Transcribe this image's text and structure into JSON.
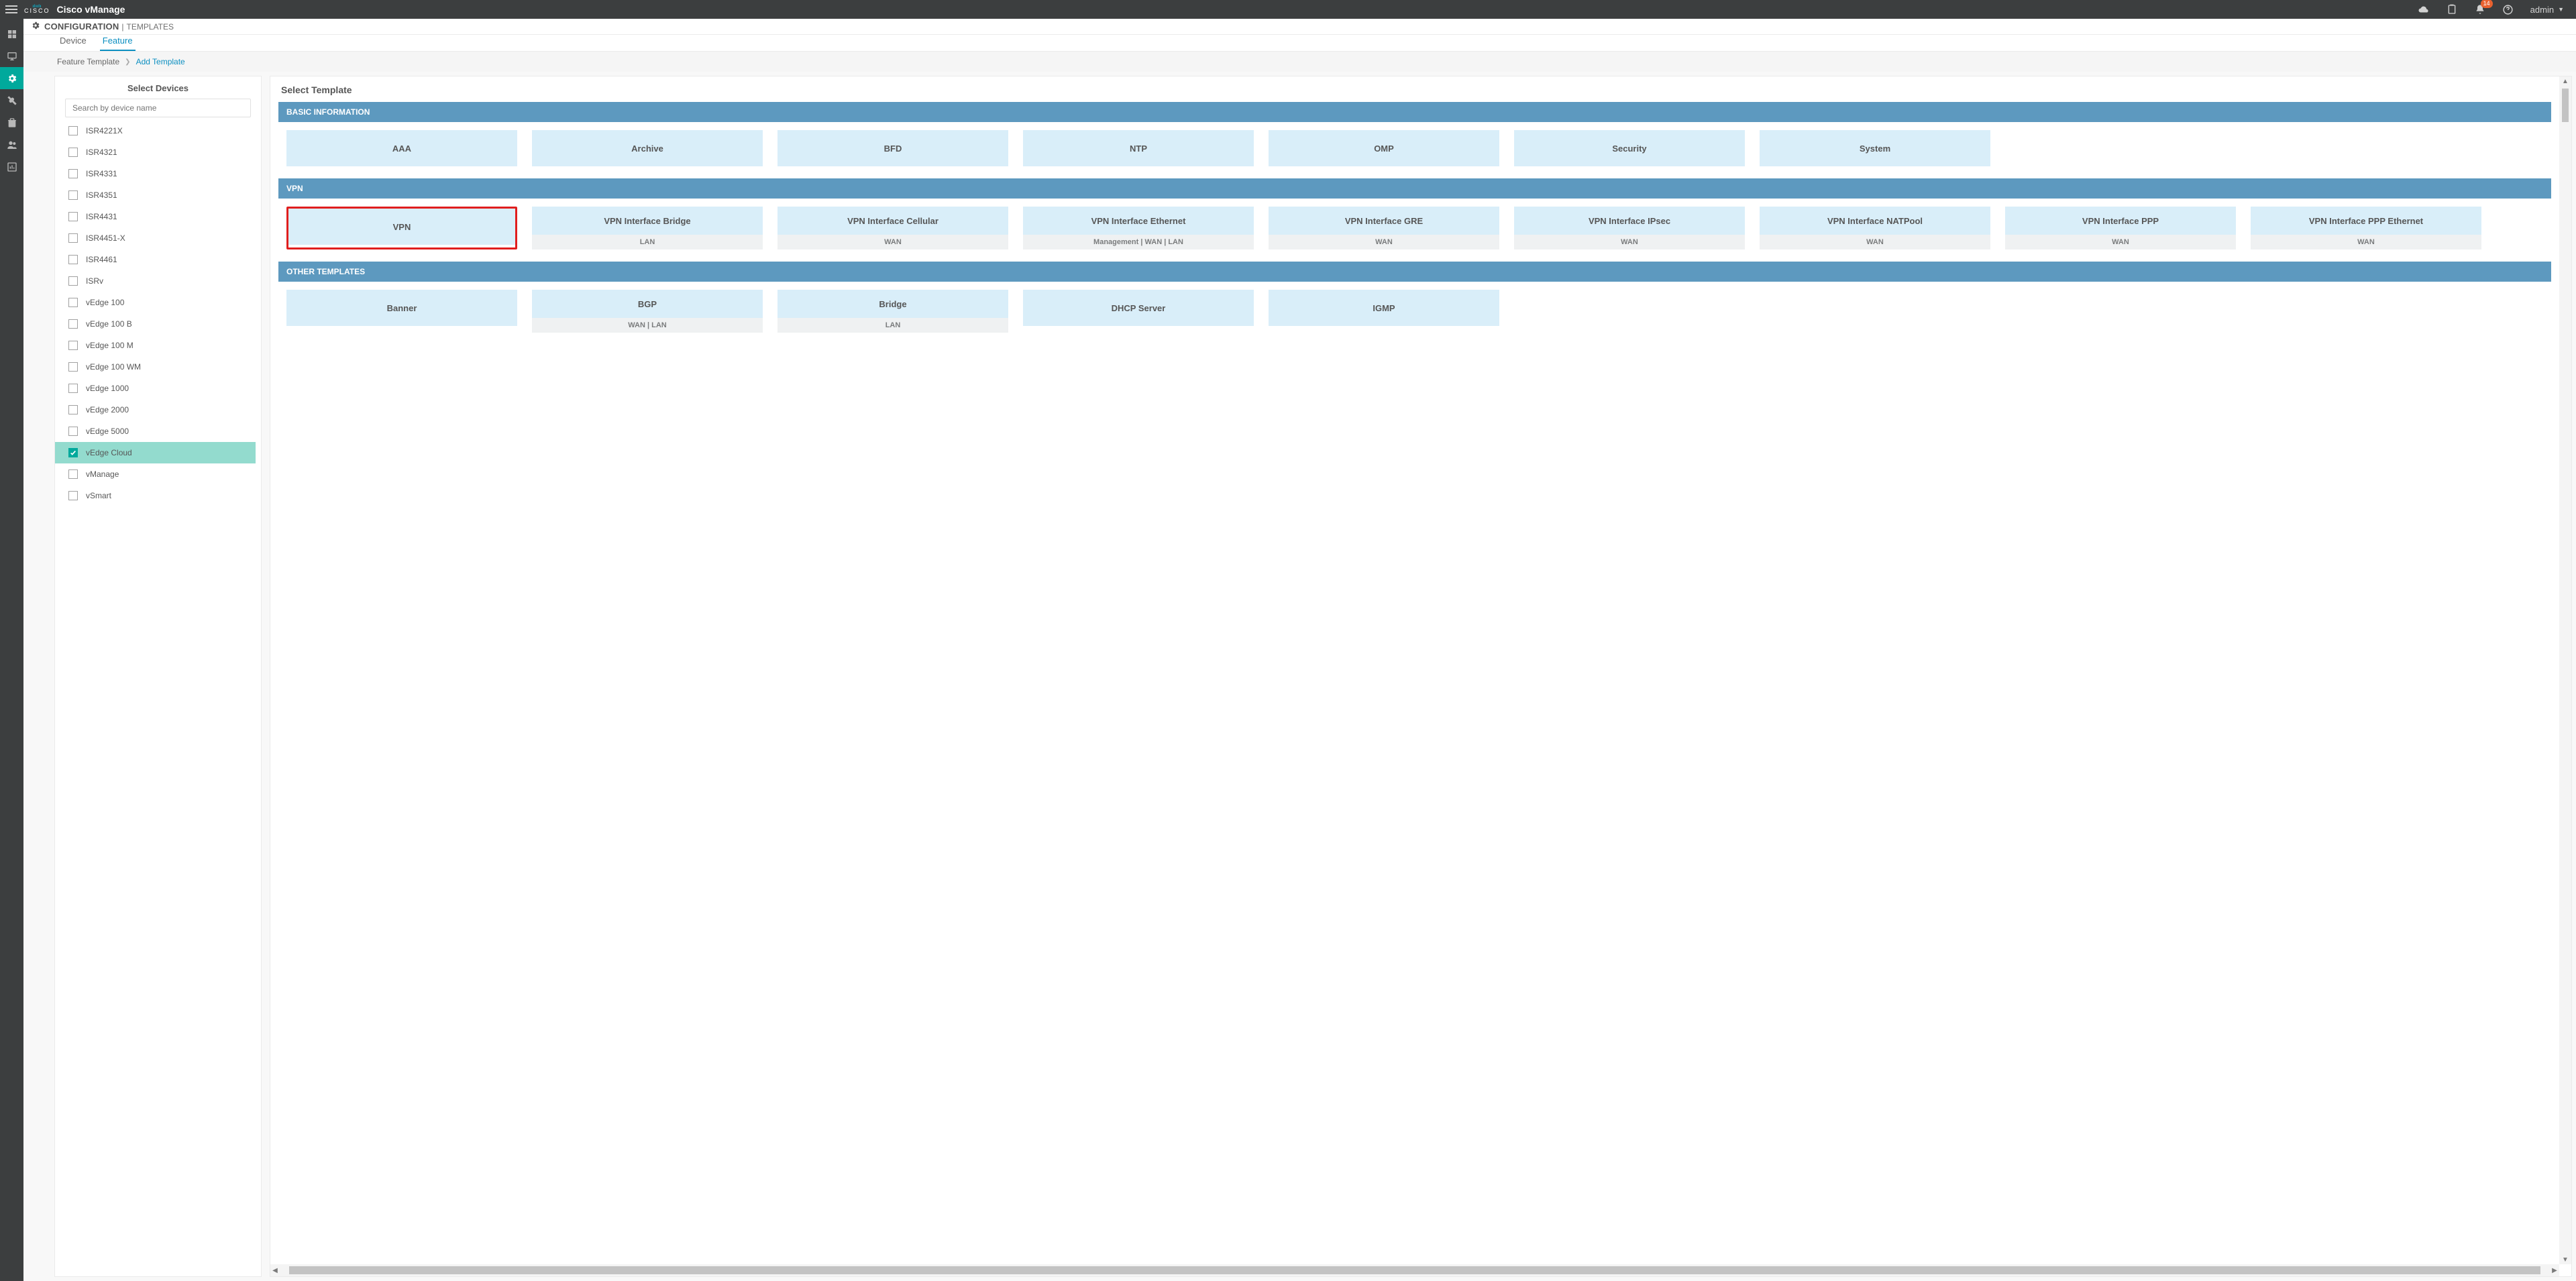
{
  "topbar": {
    "product": "Cisco vManage",
    "brand_top": "ılıılı",
    "brand_bottom": "CISCO",
    "notification_count": "14",
    "user": "admin"
  },
  "page_header": {
    "main": "CONFIGURATION",
    "sub": "TEMPLATES"
  },
  "tabs": {
    "device": "Device",
    "feature": "Feature"
  },
  "breadcrumb": {
    "item1": "Feature Template",
    "item2": "Add Template"
  },
  "devices_panel": {
    "title": "Select Devices",
    "search_placeholder": "Search by device name",
    "items": [
      {
        "label": "ISR4221X"
      },
      {
        "label": "ISR4321"
      },
      {
        "label": "ISR4331"
      },
      {
        "label": "ISR4351"
      },
      {
        "label": "ISR4431"
      },
      {
        "label": "ISR4451-X"
      },
      {
        "label": "ISR4461"
      },
      {
        "label": "ISRv"
      },
      {
        "label": "vEdge 100"
      },
      {
        "label": "vEdge 100 B"
      },
      {
        "label": "vEdge 100 M"
      },
      {
        "label": "vEdge 100 WM"
      },
      {
        "label": "vEdge 1000"
      },
      {
        "label": "vEdge 2000"
      },
      {
        "label": "vEdge 5000"
      },
      {
        "label": "vEdge Cloud",
        "selected": true
      },
      {
        "label": "vManage"
      },
      {
        "label": "vSmart"
      }
    ]
  },
  "templates_panel": {
    "title": "Select Template",
    "sections": {
      "basic": "BASIC INFORMATION",
      "vpn": "VPN",
      "other": "OTHER TEMPLATES"
    },
    "basic_tiles": [
      {
        "t": "AAA"
      },
      {
        "t": "Archive"
      },
      {
        "t": "BFD"
      },
      {
        "t": "NTP"
      },
      {
        "t": "OMP"
      },
      {
        "t": "Security"
      },
      {
        "t": "System"
      }
    ],
    "vpn_tiles": [
      {
        "t": "VPN",
        "highlight": true
      },
      {
        "t": "VPN Interface Bridge",
        "s": "LAN"
      },
      {
        "t": "VPN Interface Cellular",
        "s": "WAN"
      },
      {
        "t": "VPN Interface Ethernet",
        "s": "Management | WAN | LAN"
      },
      {
        "t": "VPN Interface GRE",
        "s": "WAN"
      },
      {
        "t": "VPN Interface IPsec",
        "s": "WAN"
      },
      {
        "t": "VPN Interface NATPool",
        "s": "WAN"
      },
      {
        "t": "VPN Interface PPP",
        "s": "WAN"
      },
      {
        "t": "VPN Interface PPP Ethernet",
        "s": "WAN"
      }
    ],
    "other_tiles": [
      {
        "t": "Banner"
      },
      {
        "t": "BGP",
        "s": "WAN | LAN"
      },
      {
        "t": "Bridge",
        "s": "LAN"
      },
      {
        "t": "DHCP Server"
      },
      {
        "t": "IGMP"
      }
    ]
  }
}
